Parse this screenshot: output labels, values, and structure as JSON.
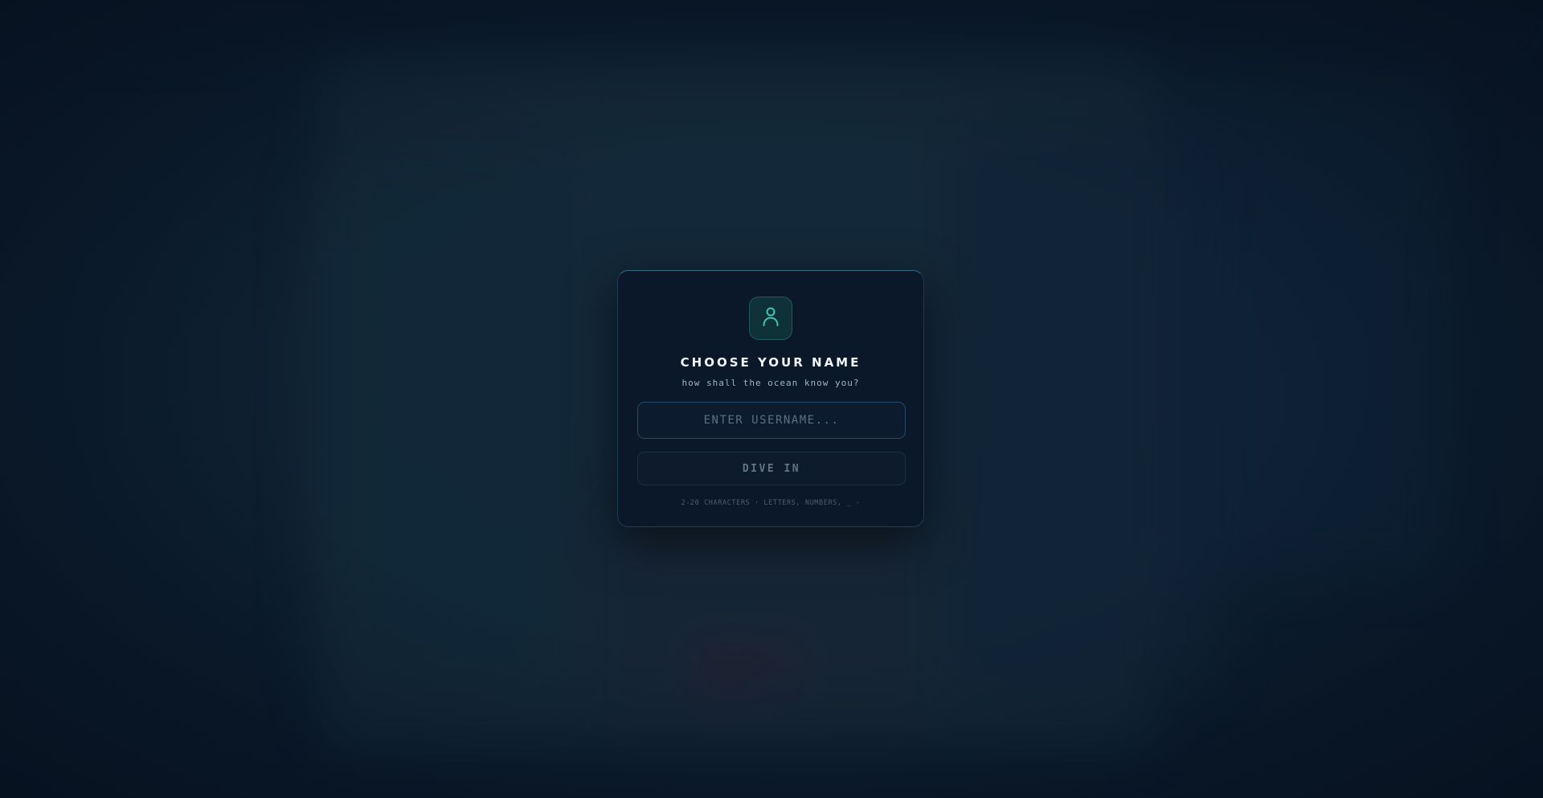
{
  "dialog": {
    "icon": "user-icon",
    "title": "CHOOSE YOUR NAME",
    "subtitle": "how shall the ocean know you?",
    "username_input": {
      "value": "",
      "placeholder": "ENTER USERNAME..."
    },
    "submit_label": "DIVE IN",
    "hint": "2-20 CHARACTERS · LETTERS, NUMBERS, _ -"
  },
  "colors": {
    "accent": "#3fc7b2",
    "background": "#0a1a2a",
    "card": "#0b1829"
  }
}
